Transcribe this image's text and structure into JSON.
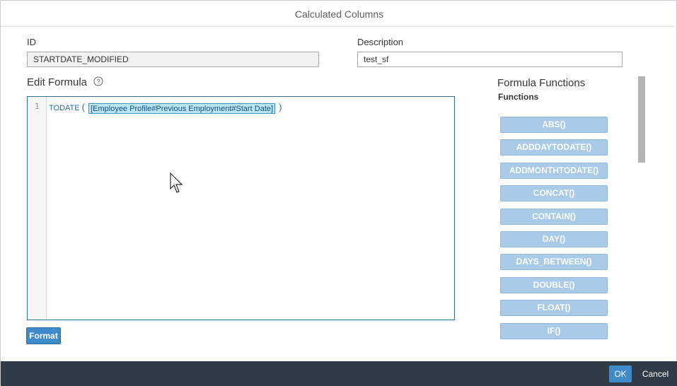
{
  "dialog": {
    "title": "Calculated Columns"
  },
  "fields": {
    "id_label": "ID",
    "id_value": "STARTDATE_MODIFIED",
    "description_label": "Description",
    "description_value": "test_sf"
  },
  "editor": {
    "title": "Edit Formula",
    "line_number": "1",
    "function_name": "TODATE",
    "open_paren": "(",
    "field_token": "[Employee Profile#Previous Employment#Start Date]",
    "close_paren": ")",
    "format_label": "Format"
  },
  "functions": {
    "header": "Formula Functions",
    "subheader": "Functions",
    "items": [
      "ABS()",
      "ADDDAYTODATE()",
      "ADDMONTHTODATE()",
      "CONCAT()",
      "CONTAIN()",
      "DAY()",
      "DAYS_BETWEEN()",
      "DOUBLE()",
      "FLOAT()",
      "IF()"
    ]
  },
  "footer": {
    "ok_label": "OK",
    "cancel_label": "Cancel"
  },
  "colors": {
    "accent": "#3f8ac9",
    "footer_bg": "#2f3c48",
    "function_button": "#a9cbe8"
  }
}
